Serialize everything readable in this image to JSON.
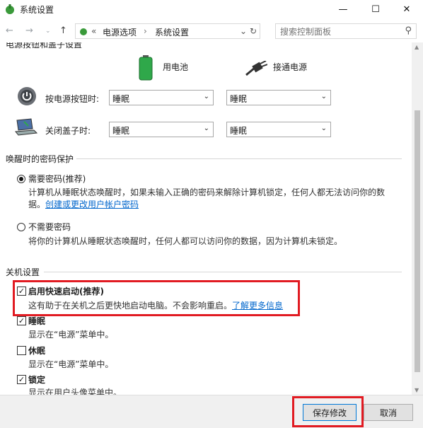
{
  "window": {
    "title": "系统设置",
    "minimize_icon": "minimize-icon",
    "maximize_icon": "maximize-icon",
    "close_icon": "close-icon"
  },
  "addressbar": {
    "back_icon": "arrow-left-icon",
    "forward_icon": "arrow-right-icon",
    "up_icon": "arrow-up-icon",
    "overflow": "«",
    "breadcrumb": [
      "电源选项",
      "系统设置"
    ],
    "search_placeholder": "搜索控制面板"
  },
  "power_buttons": {
    "heading": "电源按钮和盖子设置",
    "col_battery": "用电池",
    "col_plugged": "接通电源",
    "rows": [
      {
        "label": "按电源按钮时:",
        "battery": "睡眠",
        "plugged": "睡眠"
      },
      {
        "label": "关闭盖子时:",
        "battery": "睡眠",
        "plugged": "睡眠"
      }
    ]
  },
  "wake_password": {
    "title": "唤醒时的密码保护",
    "require_label": "需要密码(推荐)",
    "require_desc_line1": "计算机从睡眠状态唤醒时，如果未输入正确的密码来解除计算机锁定，任何人都无法访问你的数",
    "require_desc_line2": "据。",
    "require_link": "创建或更改用户帐户密码",
    "no_require_label": "不需要密码",
    "no_require_desc": "将你的计算机从睡眠状态唤醒时，任何人都可以访问你的数据，因为计算机未锁定。",
    "selected": "require"
  },
  "shutdown": {
    "title": "关机设置",
    "items": [
      {
        "label": "启用快速启动(推荐)",
        "desc": "这有助于在关机之后更快地启动电脑。不会影响重启。",
        "link": "了解更多信息",
        "checked": true
      },
      {
        "label": "睡眠",
        "desc": "显示在“电源”菜单中。",
        "checked": true
      },
      {
        "label": "休眠",
        "desc": "显示在“电源”菜单中。",
        "checked": false
      },
      {
        "label": "锁定",
        "desc": "显示在用户头像菜单中。",
        "checked": true
      }
    ]
  },
  "footer": {
    "save_label": "保存修改",
    "cancel_label": "取消"
  },
  "colors": {
    "highlight_box": "#e11b22",
    "link": "#0066cc",
    "primary_border": "#0078d7"
  }
}
